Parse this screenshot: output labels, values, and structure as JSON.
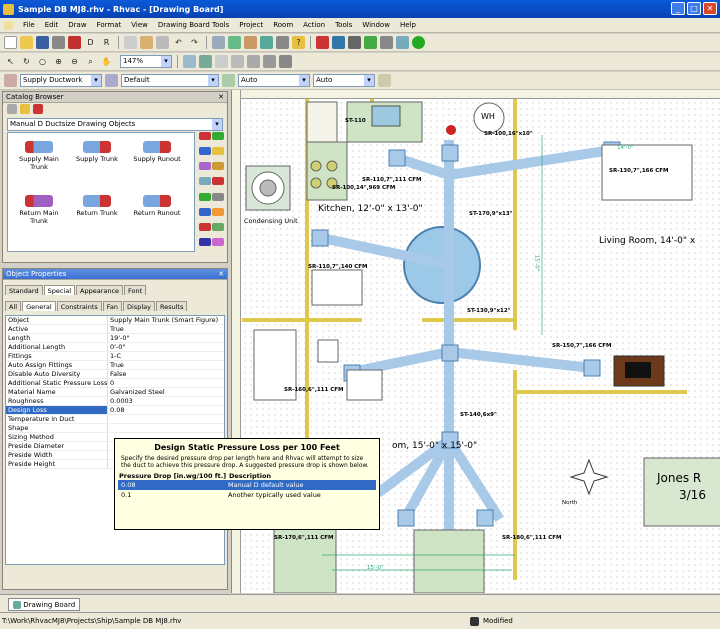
{
  "window": {
    "title": "Sample DB MJ8.rhv - Rhvac - [Drawing Board]"
  },
  "menu": [
    "File",
    "Edit",
    "Draw",
    "Format",
    "View",
    "Drawing Board Tools",
    "Project",
    "Room",
    "Action",
    "Tools",
    "Window",
    "Help"
  ],
  "toolbar2": {
    "zoom": "147%"
  },
  "toolbar3": {
    "object_type": "Supply Ductwork",
    "style": "Default",
    "auto1": "Auto",
    "auto2": "Auto"
  },
  "catalog": {
    "title": "Catalog Browser",
    "dropdown": "Manual D Ductsize Drawing Objects",
    "items": [
      {
        "label": "Supply Main Trunk"
      },
      {
        "label": "Supply Trunk"
      },
      {
        "label": "Supply Runout"
      },
      {
        "label": "Return Main Trunk"
      },
      {
        "label": "Return Trunk"
      },
      {
        "label": "Return Runout"
      }
    ]
  },
  "props": {
    "title": "Object Properties",
    "tabs_row1": [
      "Standard",
      "Special",
      "Appearance",
      "Font"
    ],
    "tabs_row2": [
      "All",
      "General",
      "Constraints",
      "Fan",
      "Display",
      "Results"
    ],
    "rows": [
      {
        "k": "Object",
        "v": "Supply Main Trunk (Smart Figure)"
      },
      {
        "k": "Active",
        "v": "True"
      },
      {
        "k": "Length",
        "v": "19'-0\""
      },
      {
        "k": "Additional Length",
        "v": "0'-0\""
      },
      {
        "k": "Fittings",
        "v": "1-C"
      },
      {
        "k": "Auto Assign Fittings",
        "v": "True"
      },
      {
        "k": "Disable Auto Diversity",
        "v": "False"
      },
      {
        "k": "Additional Static Pressure Loss",
        "v": "0"
      },
      {
        "k": "Material Name",
        "v": "Galvanized Steel"
      },
      {
        "k": "Roughness",
        "v": "0.0003"
      },
      {
        "k": "Design Loss",
        "v": "0.08"
      },
      {
        "k": "Temperature in Duct",
        "v": ""
      },
      {
        "k": "Shape",
        "v": ""
      },
      {
        "k": "Sizing Method",
        "v": ""
      },
      {
        "k": "Preside Diameter",
        "v": ""
      },
      {
        "k": "Preside Width",
        "v": ""
      },
      {
        "k": "Preside Height",
        "v": ""
      }
    ]
  },
  "tooltip": {
    "title": "Design Static Pressure Loss per 100 Feet",
    "text": "Specify the desired pressure drop per length here and Rhvac will attempt to size the duct to achieve this pressure drop. A suggested pressure drop is shown below.",
    "col1": "Pressure Drop [in.wg/100 ft.]",
    "col2": "Description",
    "rows": [
      {
        "v": "0.08",
        "d": "Manual D default value"
      },
      {
        "v": "0.1",
        "d": "Another typically used value"
      }
    ]
  },
  "drawing": {
    "labels": {
      "wh": "WH",
      "st110": "ST-110",
      "sr100_16": "SR-100,16\"x10\"",
      "cfm_top_right": "14'-0\"",
      "sr110_7": "SR-110,7\",111 CFM",
      "sr100_14": "SR-100,14\",969 CFM",
      "sr130_7": "SR-130,7\",166 CFM",
      "kitchen": "Kitchen, 12'-0\" x 13'-0\"",
      "condensing": "Condensing Unit",
      "st170": "ST-170,9\"x13\"",
      "living": "Living Room, 14'-0\" x",
      "sr110_7b": "SR-110,7\",140 CFM",
      "st130": "ST-130,9\"x12\"",
      "sr150": "SR-150,7\",166 CFM",
      "sr160": "SR-160,6\",111 CFM",
      "st140": "ST-140,6x9\"",
      "dim15": "15'-0\"",
      "dining": "om, 15'-0\" x 15'-0\"",
      "sr170": "SR-170,6\",111 CFM",
      "sr180": "SR-180,6\",111 CFM",
      "north": "North",
      "jones": "Jones R",
      "jones2": "3/16",
      "dim15b": "15'-0\""
    }
  },
  "bottom_tab": "Drawing Board",
  "status": {
    "path": "T:\\Work\\RhvacMJ8\\Projects\\Ship\\Sample DB MJ8.rhv",
    "state": "Modified"
  }
}
